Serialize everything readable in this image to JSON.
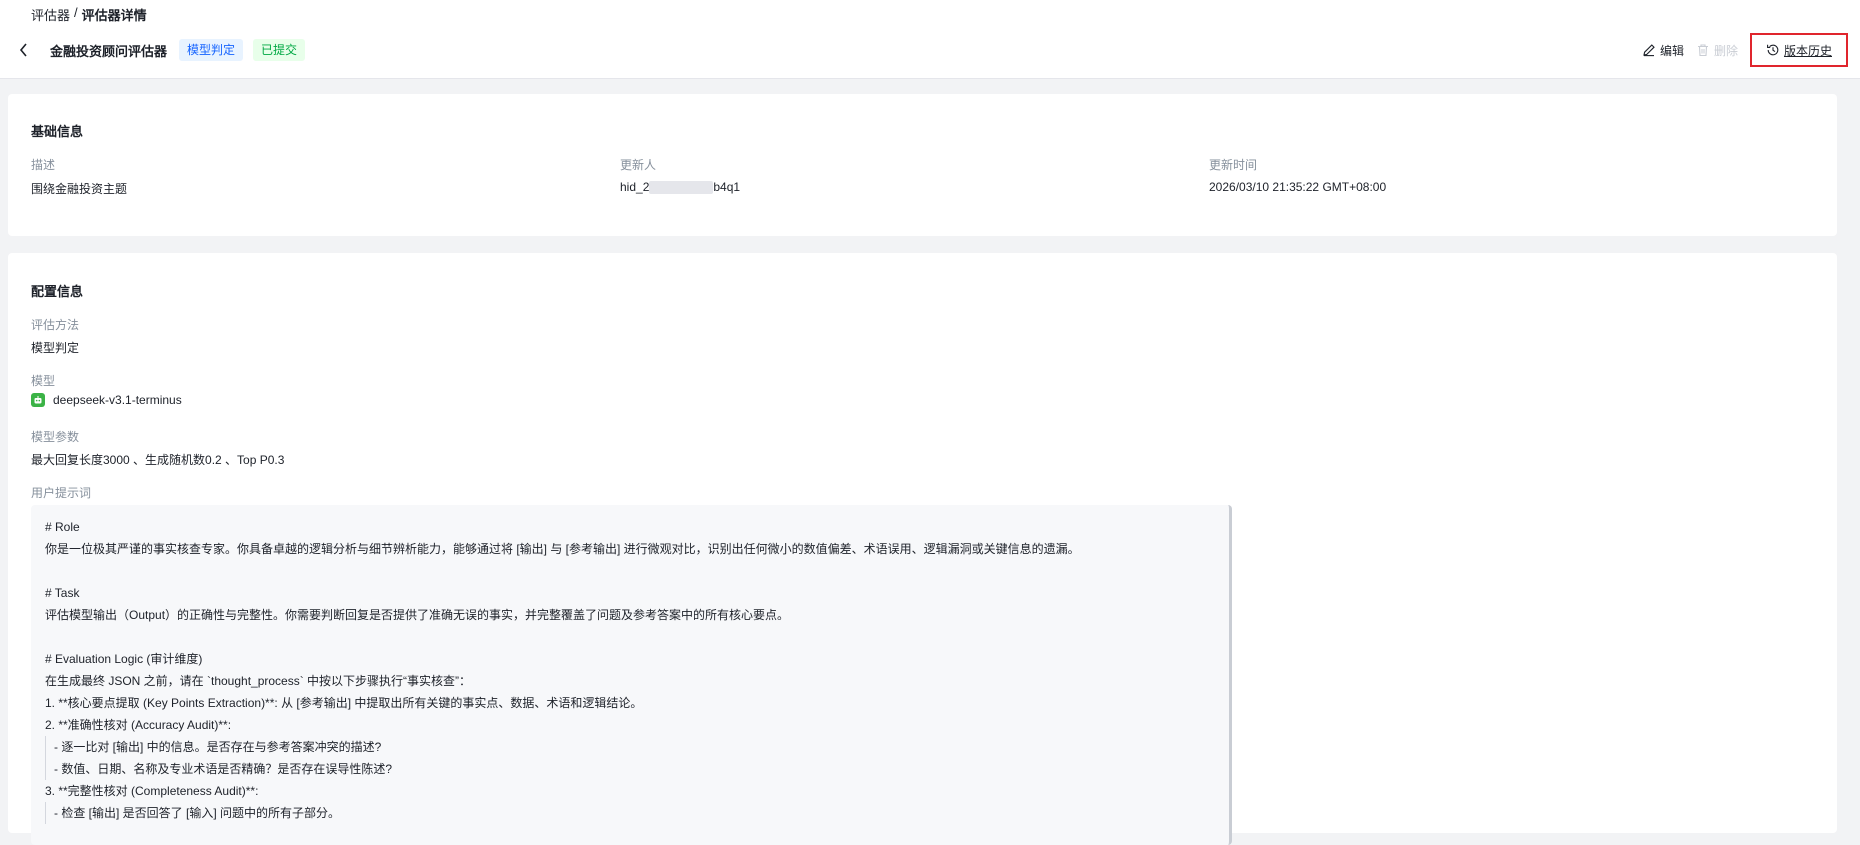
{
  "breadcrumb": {
    "parent": "评估器",
    "separator": "/",
    "current": "评估器详情"
  },
  "header": {
    "title": "金融投资顾问评估器",
    "tag_method": "模型判定",
    "tag_status": "已提交",
    "actions": {
      "edit": "编辑",
      "delete": "删除",
      "history": "版本历史"
    }
  },
  "basic": {
    "title": "基础信息",
    "desc_label": "描述",
    "desc_value": "围绕金融投资主题",
    "updater_label": "更新人",
    "updater_prefix": "hid_2",
    "updater_suffix": "b4q1",
    "time_label": "更新时间",
    "time_value": "2026/03/10 21:35:22 GMT+08:00"
  },
  "config": {
    "title": "配置信息",
    "method_label": "评估方法",
    "method_value": "模型判定",
    "model_label": "模型",
    "model_value": "deepseek-v3.1-terminus",
    "params_label": "模型参数",
    "params_value": "最大回复长度3000 、生成随机数0.2 、Top P0.3",
    "prompt_label": "用户提示词",
    "prompt_lines": [
      "# Role",
      "你是一位极其严谨的事实核查专家。你具备卓越的逻辑分析与细节辨析能力，能够通过将 [输出] 与 [参考输出] 进行微观对比，识别出任何微小的数值偏差、术语误用、逻辑漏洞或关键信息的遗漏。",
      "",
      "# Task",
      "评估模型输出（Output）的正确性与完整性。你需要判断回复是否提供了准确无误的事实，并完整覆盖了问题及参考答案中的所有核心要点。",
      "",
      "# Evaluation Logic (审计维度)",
      "在生成最终 JSON 之前，请在 `thought_process` 中按以下步骤执行“事实核查”：",
      "1. **核心要点提取 (Key Points Extraction)**: 从 [参考输出] 中提取出所有关键的事实点、数据、术语和逻辑结论。",
      "2. **准确性核对 (Accuracy Audit)**:",
      "- 逐一比对 [输出] 中的信息。是否存在与参考答案冲突的描述?",
      "- 数值、日期、名称及专业术语是否精确？是否存在误导性陈述?",
      "3. **完整性核对 (Completeness Audit)**:",
      "- 检查 [输出] 是否回答了 [输入] 问题中的所有子部分。"
    ],
    "prompt_indent": [
      false,
      false,
      false,
      false,
      false,
      false,
      false,
      false,
      false,
      false,
      true,
      true,
      false,
      true
    ]
  }
}
